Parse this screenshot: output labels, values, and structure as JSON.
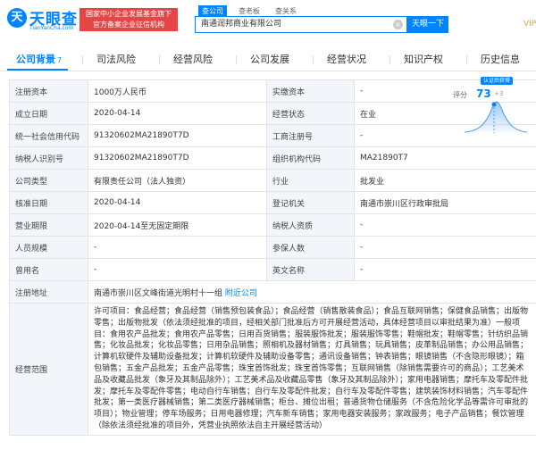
{
  "header": {
    "logo_mark": "天",
    "logo_text": "天眼查",
    "logo_sub": "TianYanCha.com",
    "gov_badge_line1": "国家中小企业发展基金旗下",
    "gov_badge_line2": "官方备案企业征信机构",
    "search_tabs": [
      "查公司",
      "查老板",
      "查关系"
    ],
    "search_value": "南通润邦商业有限公司",
    "search_button": "天眼一下",
    "vip": "VIP"
  },
  "tabs": [
    {
      "label": "公司背景",
      "count": "7"
    },
    {
      "label": "司法风险",
      "count": ""
    },
    {
      "label": "经营风险",
      "count": ""
    },
    {
      "label": "公司发展",
      "count": ""
    },
    {
      "label": "经营状况",
      "count": ""
    },
    {
      "label": "知识产权",
      "count": ""
    },
    {
      "label": "历史信息",
      "count": ""
    }
  ],
  "score": {
    "tag": "认证后获得",
    "label": "评分",
    "value": "73",
    "delta": "+3"
  },
  "info": {
    "reg_capital_label": "注册资本",
    "reg_capital": "1000万人民币",
    "paid_capital_label": "实缴资本",
    "paid_capital": "-",
    "established_label": "成立日期",
    "established": "2020-04-14",
    "status_label": "经营状态",
    "status": "在业",
    "credit_code_label": "统一社会信用代码",
    "credit_code": "91320602MA21890T7D",
    "biz_reg_label": "工商注册号",
    "biz_reg": "-",
    "taxpayer_label": "纳税人识别号",
    "taxpayer": "91320602MA21890T7D",
    "org_code_label": "组织机构代码",
    "org_code": "MA21890T7",
    "type_label": "公司类型",
    "type": "有限责任公司（法人独资）",
    "industry_label": "行业",
    "industry": "批发业",
    "approved_label": "核准日期",
    "approved": "2020-04-14",
    "authority_label": "登记机关",
    "authority": "南通市崇川区行政审批局",
    "term_label": "营业期限",
    "term": "2020-04-14至无固定期限",
    "tax_qual_label": "纳税人资质",
    "tax_qual": "-",
    "staff_label": "人员规模",
    "staff": "-",
    "insured_label": "参保人数",
    "insured": "-",
    "former_label": "曾用名",
    "former": "-",
    "en_name_label": "英文名称",
    "en_name": "-",
    "address_label": "注册地址",
    "address": "南通市崇川区文峰街道光明村十一组",
    "address_link": "附近公司",
    "scope_label": "经营范围",
    "scope": "许可项目：食品经营；食品经营（销售预包装食品）；食品经营（销售散装食品）；食品互联网销售；保健食品销售；出版物零售；出版物批发（依法须经批准的项目，经相关部门批准后方可开展经营活动，具体经营项目以审批结果为准）一般项目：食用农产品批发；食用农产品零售；日用百货销售；服装服饰批发；服装服饰零售；鞋帽批发；鞋帽零售；针纺织品销售；化妆品批发；化妆品零售；日用杂品销售；照相机及器材销售；灯具销售；玩具销售；皮革制品销售；办公用品销售；计算机软硬件及辅助设备批发；计算机软硬件及辅助设备零售；通讯设备销售；钟表销售；眼镜销售（不含隐形眼镜）；箱包销售；五金产品批发；五金产品零售；珠宝首饰批发；珠宝首饰零售；互联网销售（除销售需要许可的商品）；工艺美术品及收藏品批发（象牙及其制品除外）；工艺美术品及收藏品零售（象牙及其制品除外）；家用电器销售；摩托车及零配件批发；摩托车及零配件零售；电动自行车销售；自行车及零配件批发；自行车及零配件零售；建筑装饰材料销售；汽车零配件批发；第一类医疗器械销售；第二类医疗器械销售；柜台、摊位出租；普通货物仓储服务（不含危险化学品等需许可审批的项目）；物业管理；停车场服务；日用电器修理；汽车新车销售；家用电器安装服务；家政服务；电子产品销售；餐饮管理（除依法须经批准的项目外，凭营业执照依法自主开展经营活动）"
  }
}
